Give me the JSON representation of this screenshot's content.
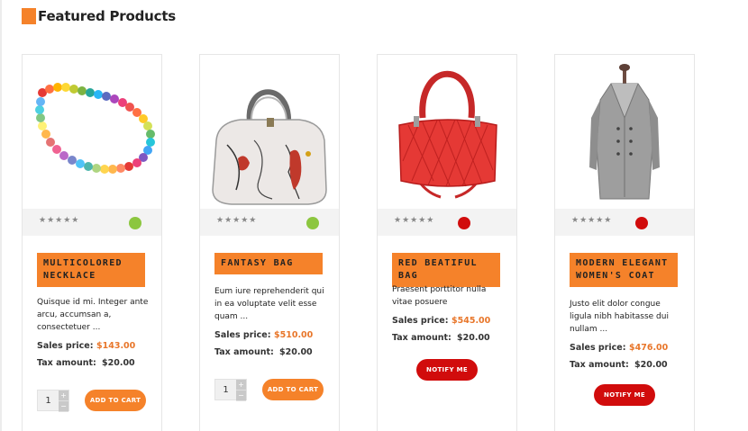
{
  "section": {
    "title": "Featured Products"
  },
  "labels": {
    "sales_price": "Sales price:",
    "tax_amount": "Tax amount:",
    "rating": "★★★★★",
    "qty_up": "+",
    "qty_down": "−"
  },
  "colors": {
    "accent": "#f5822a",
    "in_stock": "#8cc63f",
    "out_of_stock": "#d10c0c"
  },
  "products": [
    {
      "name": "MULTICOLORED NECKLACE",
      "image_icon": "necklace-image",
      "status": "in-stock",
      "description": "Quisque id mi. Integer ante arcu, accumsan a, consectetuer ...",
      "sales_price": "$143.00",
      "tax_amount": "$20.00",
      "quantity": "1",
      "action": "ADD TO CART"
    },
    {
      "name": "FANTASY BAG",
      "image_icon": "fantasy-bag-image",
      "status": "in-stock",
      "description": "Eum iure reprehenderit qui in ea voluptate velit esse quam ...",
      "sales_price": "$510.00",
      "tax_amount": "$20.00",
      "quantity": "1",
      "action": "ADD TO CART"
    },
    {
      "name": "RED BEATIFUL BAG",
      "image_icon": "red-bag-image",
      "status": "out-of-stock",
      "description": "Praesent porttitor nulla vitae posuere",
      "sales_price": "$545.00",
      "tax_amount": "$20.00",
      "action": "NOTIFY ME"
    },
    {
      "name": "MODERN ELEGANT WOMEN'S COAT",
      "image_icon": "coat-image",
      "status": "out-of-stock",
      "description": "Justo elit dolor congue ligula nibh habitasse dui nullam ...",
      "sales_price": "$476.00",
      "tax_amount": "$20.00",
      "action": "NOTIFY ME"
    }
  ]
}
